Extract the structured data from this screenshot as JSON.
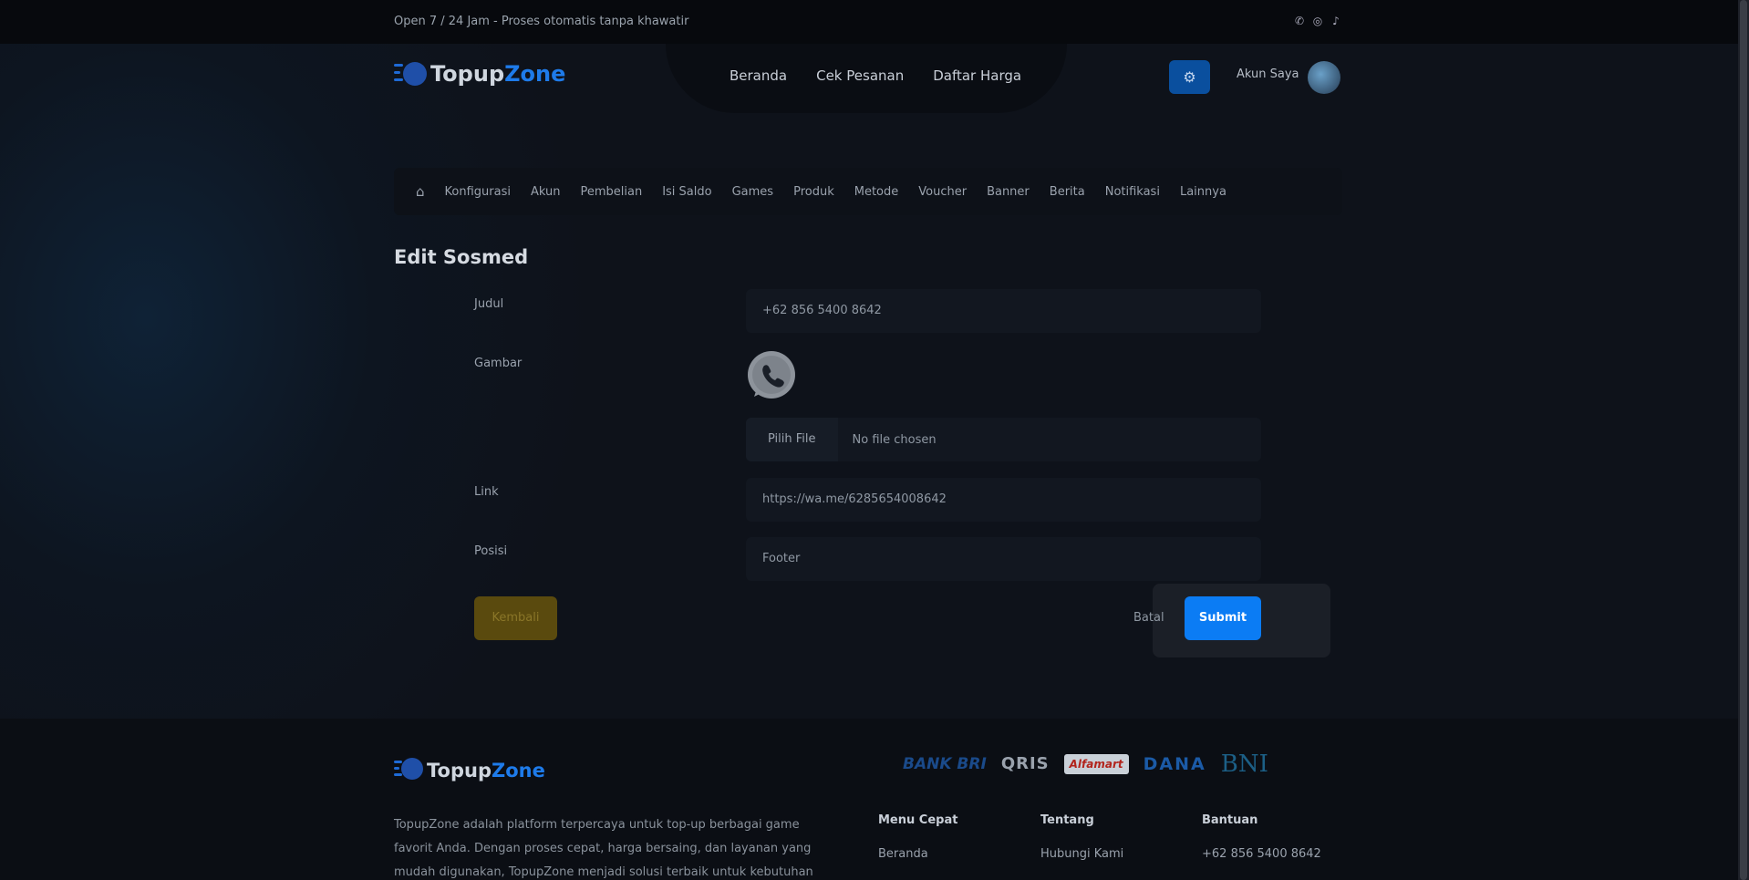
{
  "topbar": {
    "message": "Open 7 / 24 Jam - Proses otomatis tanpa khawatir"
  },
  "brand": {
    "part1": "Topup",
    "part2": "Zone"
  },
  "nav": {
    "items": [
      "Beranda",
      "Cek Pesanan",
      "Daftar Harga"
    ]
  },
  "account": {
    "label": "Akun Saya"
  },
  "admin_nav": {
    "items": [
      "Konfigurasi",
      "Akun",
      "Pembelian",
      "Isi Saldo",
      "Games",
      "Produk",
      "Metode",
      "Voucher",
      "Banner",
      "Berita",
      "Notifikasi",
      "Lainnya"
    ]
  },
  "page": {
    "title": "Edit Sosmed"
  },
  "form": {
    "judul_label": "Judul",
    "judul_value": "+62 856 5400 8642",
    "gambar_label": "Gambar",
    "file_button": "Pilih File",
    "file_status": "No file chosen",
    "link_label": "Link",
    "link_value": "https://wa.me/6285654008642",
    "posisi_label": "Posisi",
    "posisi_value": "Footer",
    "back_label": "Kembali",
    "cancel_label": "Batal",
    "submit_label": "Submit"
  },
  "footer": {
    "description": "TopupZone adalah platform terpercaya untuk top-up berbagai game favorit Anda. Dengan proses cepat, harga bersaing, dan layanan yang mudah digunakan, TopupZone menjadi solusi terbaik untuk kebutuhan top-up Anda.",
    "payments": [
      "BANK BRI",
      "QRIS",
      "Alfamart",
      "DANA",
      "BNI"
    ],
    "columns": [
      {
        "title": "Menu Cepat",
        "link": "Beranda"
      },
      {
        "title": "Tentang",
        "link": "Hubungi Kami"
      },
      {
        "title": "Bantuan",
        "link": "+62 856 5400 8642"
      }
    ]
  },
  "colors": {
    "accent": "#0b7cf4",
    "back_button": "#5a4a0e",
    "background": "#0f131b"
  }
}
